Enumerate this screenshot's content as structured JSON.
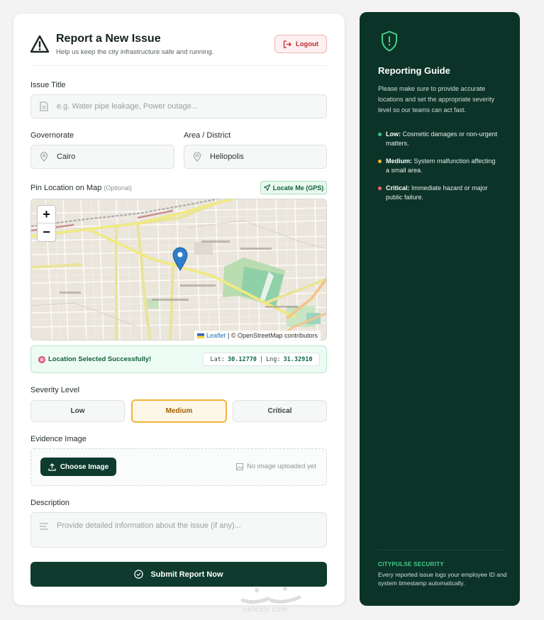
{
  "form": {
    "title": "Report a New Issue",
    "subtitle": "Help us keep the city infrastructure safe and running.",
    "logout_label": "Logout",
    "issue_title": {
      "label": "Issue Title",
      "placeholder": "e.g. Water pipe leakage, Power outage..."
    },
    "governorate": {
      "label": "Governorate",
      "value": "Cairo"
    },
    "district": {
      "label": "Area / District",
      "value": "Heliopolis"
    },
    "map": {
      "label": "Pin Location on Map",
      "optional": "(Optional)",
      "gps_label": "Locate Me (GPS)",
      "zoom_in": "+",
      "zoom_out": "−",
      "attribution_link": "Leaflet",
      "attribution_text": "| © OpenStreetMap contributors"
    },
    "location": {
      "status": "Location Selected Successfully!",
      "lat_label": "Lat:",
      "lat": "30.12770",
      "sep": "|",
      "lng_label": "Lng:",
      "lng": "31.32910"
    },
    "severity": {
      "label": "Severity Level",
      "options": [
        "Low",
        "Medium",
        "Critical"
      ],
      "selected": "Medium"
    },
    "evidence": {
      "label": "Evidence Image",
      "button": "Choose Image",
      "status": "No image uploaded yet"
    },
    "description": {
      "label": "Description",
      "placeholder": "Provide detailed information about the issue (if any)..."
    },
    "submit_label": "Submit Report Now"
  },
  "guide": {
    "title": "Reporting Guide",
    "intro": "Please make sure to provide accurate locations and set the appropriate severity level so our teams can act fast.",
    "items": [
      {
        "level": "Low:",
        "text": "Cosmetic damages or non-urgent matters.",
        "color": "#34c98a"
      },
      {
        "level": "Medium:",
        "text": "System malfunction affecting a small area.",
        "color": "#f2b43a"
      },
      {
        "level": "Critical:",
        "text": "Immediate hazard or major public failure.",
        "color": "#ef6b6b"
      }
    ],
    "security_title": "CITYPULSE SECURITY",
    "security_text": "Every reported issue logs your employee ID and system timestamp automatically."
  },
  "watermark": {
    "text": "nafezly.com"
  },
  "colors": {
    "primary": "#0e3b2e",
    "accent_green": "#43d08b",
    "danger": "#c0282d",
    "warning": "#f2b43a"
  }
}
